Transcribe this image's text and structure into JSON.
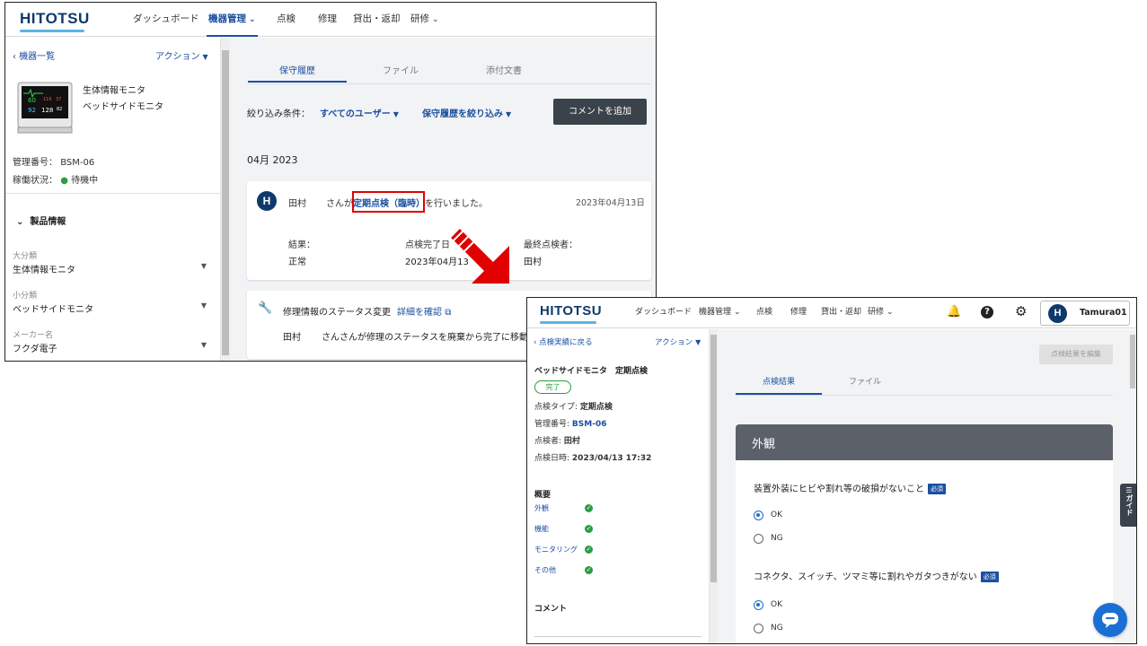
{
  "colors": {
    "brand": "#0e3a6b",
    "accent": "#1b4fa0",
    "status_green": "#2e9b45",
    "highlight_red": "#e00000",
    "arrow_red": "#e00000"
  },
  "window1": {
    "logo": "HITOTSU",
    "nav": [
      {
        "label": "ダッシュボード"
      },
      {
        "label": "機器管理"
      },
      {
        "label": "点検"
      },
      {
        "label": "修理"
      },
      {
        "label": "貸出・返却"
      },
      {
        "label": "研修"
      }
    ],
    "sidebar": {
      "back_label": "機器一覧",
      "action_label": "アクション",
      "device_name1": "生体情報モニタ",
      "device_name2": "ベッドサイドモニタ",
      "mgmt_no_label": "管理番号：",
      "mgmt_no": "BSM-06",
      "status_label": "稼働状況：",
      "status_value": "待機中",
      "product_section": "製品情報",
      "fields": [
        {
          "label": "大分類",
          "value": "生体情報モニタ"
        },
        {
          "label": "小分類",
          "value": "ベッドサイドモニタ"
        },
        {
          "label": "メーカー名",
          "value": "フクダ電子"
        }
      ],
      "monitor_readouts": {
        "hr": "60",
        "spo2": "92",
        "nibp": "128",
        "extra": "82",
        "small1": "116",
        "small2": "37"
      }
    },
    "main": {
      "tabs": [
        "保守履歴",
        "ファイル",
        "添付文書"
      ],
      "filter_label": "絞り込み条件：",
      "filter_users": "すべてのユーザー",
      "filter_history": "保守履歴を絞り込み",
      "add_comment": "コメントを追加",
      "month_header": "04月 2023",
      "entry": {
        "avatar": "H",
        "user": "田村",
        "prefix": "さんが",
        "link": "定期点検（臨時）",
        "suffix": "を行いました。",
        "date": "2023年04月13日",
        "col1_label": "結果：",
        "col1_value": "正常",
        "col2_label": "点検完了日",
        "col2_value": "2023年04月13",
        "col3_label": "最終点検者：",
        "col3_value": "田村"
      },
      "entry2": {
        "title": "修理情報のステータス変更",
        "detail_link": "詳細を確認",
        "user": "田村",
        "text": "さんさんが修理のステータスを廃棄から完了に移動"
      }
    }
  },
  "window2": {
    "logo": "HITOTSU",
    "nav": [
      {
        "label": "ダッシュボード"
      },
      {
        "label": "機器管理"
      },
      {
        "label": "点検"
      },
      {
        "label": "修理"
      },
      {
        "label": "貸出・返却"
      },
      {
        "label": "研修"
      }
    ],
    "user_avatar": "H",
    "user_name": "Tamura01",
    "sidebar": {
      "back_label": "点検実績に戻る",
      "action_label": "アクション",
      "title": "ベッドサイドモニタ　定期点検",
      "status_pill": "完了",
      "rows": [
        {
          "label": "点検タイプ:",
          "value": "定期点検"
        },
        {
          "label": "管理番号:",
          "value": "BSM-06"
        },
        {
          "label": "点検者:",
          "value": "田村"
        },
        {
          "label": "点検日時:",
          "value": "2023/04/13 17:32"
        }
      ],
      "summary_title": "概要",
      "summary_items": [
        "外観",
        "機能",
        "モニタリング",
        "その他"
      ],
      "comment_title": "コメント"
    },
    "main": {
      "edit_button": "点検結果を編集",
      "tabs": [
        "点検結果",
        "ファイル"
      ],
      "section_title": "外観",
      "required_badge": "必須",
      "questions": [
        {
          "text": "装置外装にヒビや割れ等の破損がないこと",
          "options": [
            "OK",
            "NG"
          ]
        },
        {
          "text": "コネクタ、スイッチ、ツマミ等に割れやガタつきがない",
          "options": [
            "OK",
            "NG"
          ]
        }
      ],
      "guide_label": "ガイド"
    }
  }
}
